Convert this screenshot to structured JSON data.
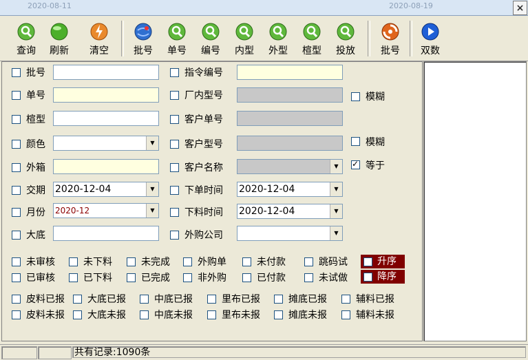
{
  "window": {
    "ghost_dates": [
      "2020-08-11",
      "2020-08-19"
    ],
    "close_symbol": "×"
  },
  "toolbar": {
    "buttons": [
      {
        "label": "查询",
        "icon": "magnifier-icon"
      },
      {
        "label": "刷新",
        "icon": "refresh-icon"
      },
      {
        "label": "清空",
        "icon": "lightning-icon"
      },
      {
        "label": "批号",
        "icon": "globe-icon"
      },
      {
        "label": "单号",
        "icon": "magnifier-icon"
      },
      {
        "label": "编号",
        "icon": "magnifier-icon"
      },
      {
        "label": "内型",
        "icon": "magnifier-icon"
      },
      {
        "label": "外型",
        "icon": "magnifier-icon"
      },
      {
        "label": "楦型",
        "icon": "magnifier-icon"
      },
      {
        "label": "投放",
        "icon": "magnifier-icon"
      },
      {
        "label": "批号",
        "icon": "swirl-icon"
      },
      {
        "label": "双数",
        "icon": "play-icon"
      }
    ]
  },
  "form": {
    "left": [
      {
        "label": "批号",
        "value": "",
        "style": "white"
      },
      {
        "label": "单号",
        "value": "",
        "style": "yellow"
      },
      {
        "label": "楦型",
        "value": "",
        "style": "white"
      },
      {
        "label": "颜色",
        "value": "",
        "style": "white",
        "dropdown": true
      },
      {
        "label": "外箱",
        "value": "",
        "style": "yellow"
      },
      {
        "label": "交期",
        "value": "2020-12-04",
        "style": "white",
        "dropdown": true
      },
      {
        "label": "月份",
        "value": "2020-12",
        "style": "small",
        "dropdown": true
      },
      {
        "label": "大底",
        "value": "",
        "style": "white"
      }
    ],
    "middle": [
      {
        "label": "指令编号",
        "value": "",
        "style": "yellow"
      },
      {
        "label": "厂内型号",
        "value": "",
        "style": "gray"
      },
      {
        "label": "客户单号",
        "value": "",
        "style": "gray"
      },
      {
        "label": "客户型号",
        "value": "",
        "style": "gray"
      },
      {
        "label": "客户名称",
        "value": "",
        "style": "gray",
        "dropdown": true
      },
      {
        "label": "下单时间",
        "value": "2020-12-04",
        "style": "white",
        "dropdown": true
      },
      {
        "label": "下料时间",
        "value": "2020-12-04",
        "style": "white",
        "dropdown": true
      },
      {
        "label": "外购公司",
        "value": "",
        "style": "white",
        "dropdown": true
      }
    ],
    "right_options": [
      {
        "label": "模糊",
        "checked": false
      },
      {
        "label": "模糊",
        "checked": false
      },
      {
        "label": "等于",
        "checked": true
      }
    ]
  },
  "status_filters": {
    "row1": [
      "未审核",
      "未下料",
      "未完成",
      "外购单",
      "未付款",
      "跳码试"
    ],
    "row2": [
      "已审核",
      "已下料",
      "已完成",
      "非外购",
      "已付款",
      "未试做"
    ]
  },
  "sort": {
    "asc": "升序",
    "desc": "降序"
  },
  "report_filters": {
    "row1": [
      "皮料已报",
      "大底已报",
      "中底已报",
      "里布已报",
      "摊底已报",
      "辅料已报"
    ],
    "row2": [
      "皮料未报",
      "大底未报",
      "中底未报",
      "里布未报",
      "摊底未报",
      "辅料未报"
    ]
  },
  "status_bar": {
    "record_text": "共有记录:1090条"
  },
  "colors": {
    "sort_bg": "#800000",
    "yellow_field": "#ffffe0",
    "gray_field": "#c8c8c8"
  }
}
